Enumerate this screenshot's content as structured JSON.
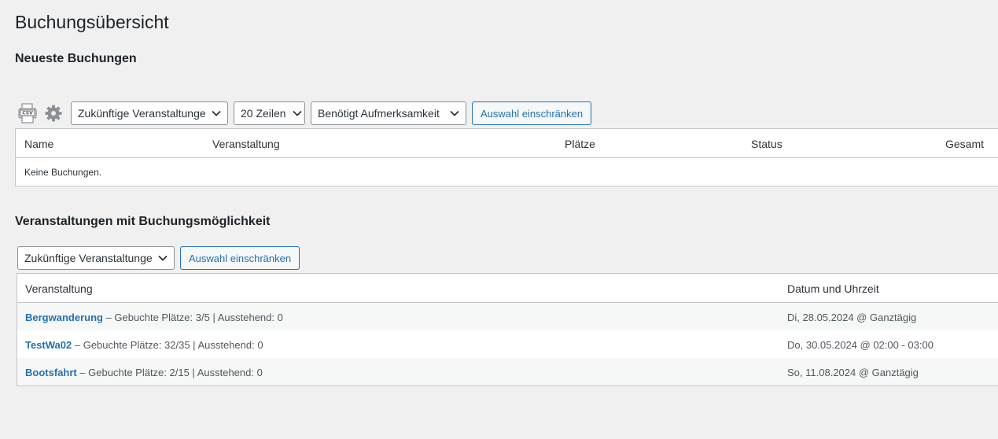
{
  "page": {
    "title": "Buchungsübersicht"
  },
  "recent": {
    "title": "Neueste Buchungen",
    "csv_icon_text": "CSV",
    "filters": {
      "time_filter": "Zukünftige Veranstaltungen",
      "rows_filter": "20 Zeilen",
      "status_filter": "Benötigt Aufmerksamkeit",
      "apply_label": "Auswahl einschränken"
    },
    "columns": {
      "name": "Name",
      "event": "Veranstaltung",
      "spaces": "Plätze",
      "status": "Status",
      "total": "Gesamt"
    },
    "empty_text": "Keine Buchungen."
  },
  "events": {
    "title": "Veranstaltungen mit Buchungsmöglichkeit",
    "filters": {
      "time_filter": "Zukünftige Veranstaltungen",
      "apply_label": "Auswahl einschränken"
    },
    "columns": {
      "event": "Veranstaltung",
      "datetime": "Datum und Uhrzeit"
    },
    "rows": [
      {
        "name": "Bergwanderung",
        "details": " – Gebuchte Plätze: 3/5 | Ausstehend: 0",
        "datetime": "Di, 28.05.2024 @ Ganztägig"
      },
      {
        "name": "TestWa02",
        "details": " – Gebuchte Plätze: 32/35 | Ausstehend: 0",
        "datetime": "Do, 30.05.2024 @ 02:00 - 03:00"
      },
      {
        "name": "Bootsfahrt",
        "details": " – Gebuchte Plätze: 2/15 | Ausstehend: 0",
        "datetime": "So, 11.08.2024 @ Ganztägig"
      }
    ]
  },
  "colors": {
    "link": "#2271b1",
    "border": "#c3c4c7",
    "background": "#f0f0f1"
  }
}
